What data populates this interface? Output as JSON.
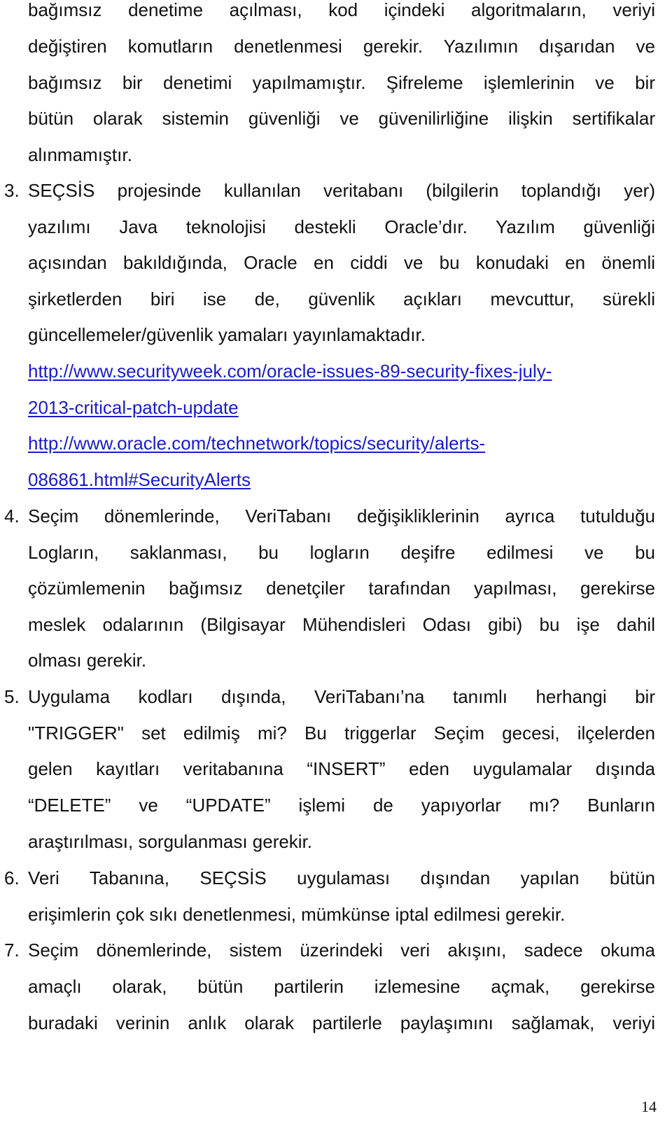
{
  "document": {
    "intro_lines": [
      "bağımsız denetime açılması, kod içindeki algoritmaların, veriyi",
      "değiştiren komutların denetlenmesi gerekir. Yazılımın dışarıdan ve",
      "bağımsız bir denetimi yapılmamıştır. Şifreleme işlemlerinin ve bir",
      "bütün olarak sistemin güvenliği ve güvenilirliğine ilişkin sertifikalar",
      "alınmamıştır."
    ],
    "items": [
      {
        "number": "3.",
        "lines": [
          "SEÇSİS projesinde kullanılan veritabanı (bilgilerin toplandığı yer)",
          "yazılımı Java teknolojisi destekli Oracle’dır. Yazılım güvenliği",
          "açısından bakıldığında, Oracle en ciddi ve bu konudaki en önemli",
          "şirketlerden biri ise de, güvenlik açıkları mevcuttur,  sürekli",
          "güncellemeler/güvenlik yamaları yayınlamaktadır."
        ],
        "links": [
          [
            "http://www.securityweek.com/oracle-issues-89-security-fixes-july-",
            "2013-critical-patch-update"
          ],
          [
            "http://www.oracle.com/technetwork/topics/security/alerts-",
            "086861.html#SecurityAlerts"
          ]
        ]
      },
      {
        "number": "4.",
        "lines": [
          "Seçim dönemlerinde, VeriTabanı değişikliklerinin ayrıca tutulduğu",
          "Logların, saklanması, bu logların deşifre edilmesi ve bu",
          "çözümlemenin bağımsız denetçiler tarafından yapılması, gerekirse",
          "meslek odalarının (Bilgisayar Mühendisleri Odası gibi) bu işe dahil",
          "olması gerekir."
        ]
      },
      {
        "number": "5.",
        "lines": [
          "Uygulama kodları dışında, VeriTabanı’na tanımlı herhangi bir",
          "\"TRIGGER\" set edilmiş mi? Bu triggerlar Seçim gecesi, ilçelerden",
          "gelen kayıtları veritabanına “INSERT” eden uygulamalar dışında",
          "“DELETE” ve “UPDATE” işlemi de yapıyorlar mı? Bunların",
          "araştırılması, sorgulanması gerekir."
        ]
      },
      {
        "number": "6.",
        "lines": [
          "Veri Tabanına, SEÇSİS uygulaması dışından yapılan bütün",
          "erişimlerin çok sıkı denetlenmesi, mümkünse iptal edilmesi gerekir."
        ]
      },
      {
        "number": "7.",
        "lines": [
          "Seçim dönemlerinde, sistem üzerindeki veri akışını, sadece okuma",
          "amaçlı olarak, bütün partilerin izlemesine açmak, gerekirse",
          "buradaki verinin anlık olarak partilerle paylaşımını sağlamak, veriyi"
        ]
      }
    ],
    "page_number": "14",
    "link_color": "#1a1ad0"
  }
}
